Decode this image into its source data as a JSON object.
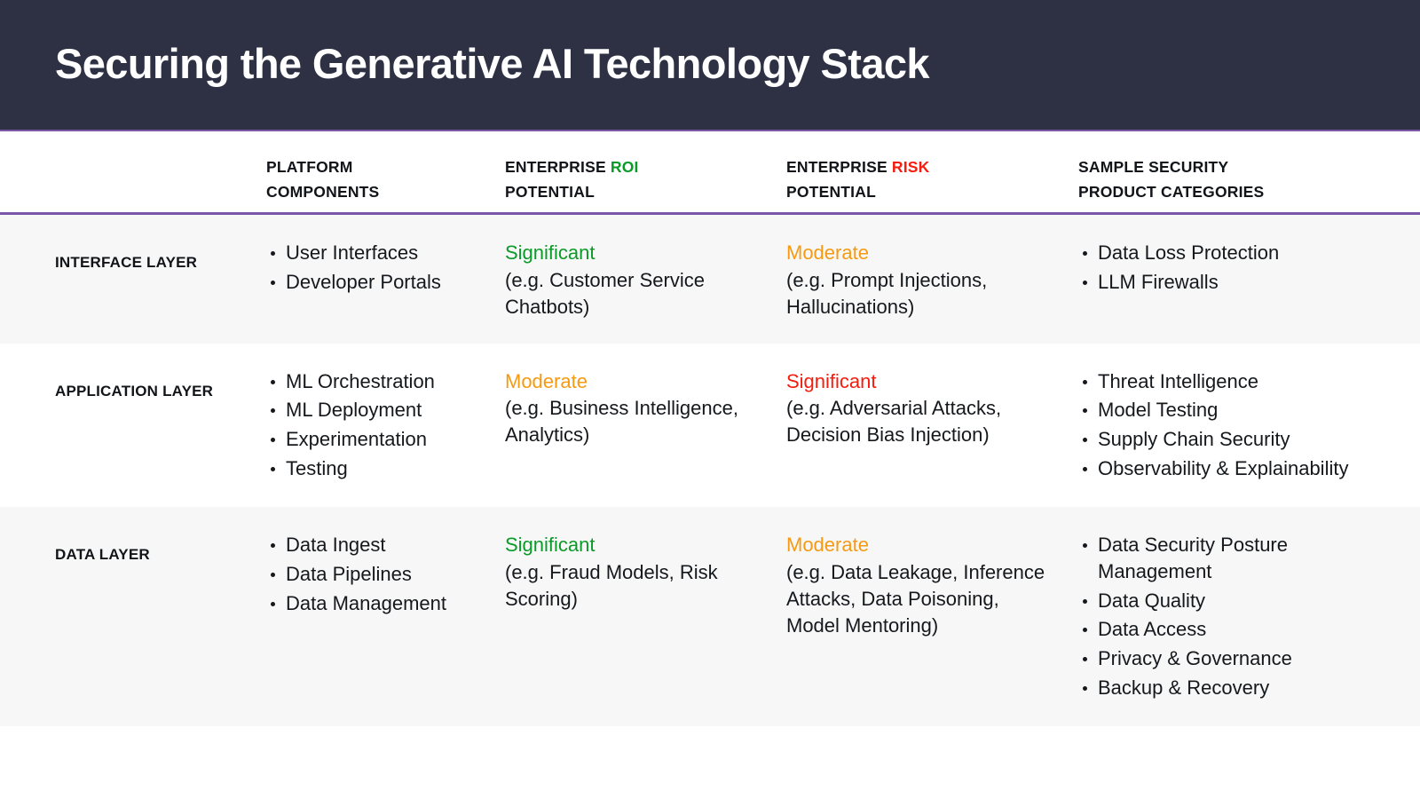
{
  "header": {
    "title": "Securing the Generative AI Technology Stack",
    "background_color": "#2e3044",
    "accent_rule_color": "#7b57a8"
  },
  "colors": {
    "positive_green": "#0a9b28",
    "moderate_orange": "#f59a12",
    "negative_red": "#f51d0e",
    "row_shaded": "#f7f7f7",
    "row_plain": "#ffffff"
  },
  "columns": {
    "layer": {
      "line1": "",
      "line2": ""
    },
    "components": {
      "line1": "PLATFORM",
      "line2": "COMPONENTS"
    },
    "roi": {
      "line1_prefix": "ENTERPRISE ",
      "line1_accent": "ROI",
      "line2": "POTENTIAL"
    },
    "risk": {
      "line1_prefix": "ENTERPRISE ",
      "line1_accent": "RISK",
      "line2": "POTENTIAL"
    },
    "products": {
      "line1": "SAMPLE SECURITY",
      "line2": "PRODUCT CATEGORIES"
    }
  },
  "rows": [
    {
      "layer": "INTERFACE LAYER",
      "components": [
        "User Interfaces",
        "Developer Portals"
      ],
      "roi": {
        "rating": "Significant",
        "rating_tone": "positive",
        "detail": "(e.g. Customer Service Chatbots)"
      },
      "risk": {
        "rating": "Moderate",
        "rating_tone": "moderate",
        "detail": "(e.g. Prompt Injections, Hallucinations)"
      },
      "products": [
        "Data Loss Protection",
        "LLM Firewalls"
      ]
    },
    {
      "layer": "APPLICATION LAYER",
      "components": [
        "ML Orchestration",
        "ML Deployment",
        "Experimentation",
        "Testing"
      ],
      "roi": {
        "rating": "Moderate",
        "rating_tone": "moderate",
        "detail": " (e.g. Business Intelligence, Analytics)"
      },
      "risk": {
        "rating": "Significant",
        "rating_tone": "negative",
        "detail": "(e.g. Adversarial Attacks, Decision Bias Injection)"
      },
      "products": [
        "Threat Intelligence",
        "Model Testing",
        "Supply Chain Security",
        "Observability & Explainability"
      ]
    },
    {
      "layer": "DATA LAYER",
      "components": [
        "Data Ingest",
        "Data Pipelines",
        "Data Management"
      ],
      "roi": {
        "rating": "Significant",
        "rating_tone": "positive",
        "detail": " (e.g. Fraud Models, Risk Scoring)"
      },
      "risk": {
        "rating": "Moderate",
        "rating_tone": "moderate",
        "detail": "(e.g. Data Leakage, Inference Attacks, Data Poisoning, Model Mentoring)"
      },
      "products": [
        "Data Security Posture Management",
        "Data Quality",
        "Data Access",
        "Privacy & Governance",
        "Backup & Recovery"
      ]
    }
  ]
}
